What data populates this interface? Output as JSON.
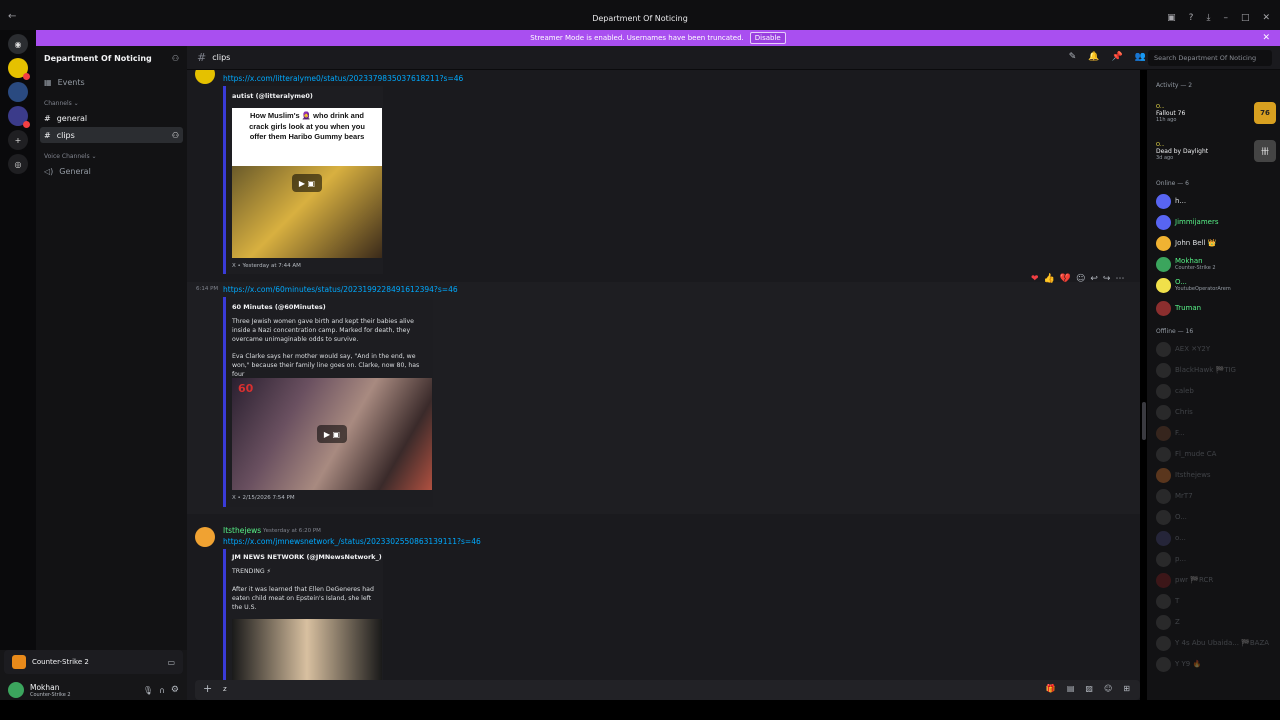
{
  "window": {
    "title": "Department Of Noticing"
  },
  "banner": {
    "text": "Streamer Mode is enabled. Usernames have been truncated.",
    "button": "Disable"
  },
  "guild": {
    "name": "Department Of Noticing"
  },
  "sidebar": {
    "events": "Events",
    "channels_category": "Channels",
    "channels": [
      {
        "name": "general"
      },
      {
        "name": "clips"
      }
    ],
    "voice_category": "Voice Channels",
    "voice_channels": [
      {
        "name": "General"
      }
    ]
  },
  "activity_card": {
    "title": "Counter-Strike 2"
  },
  "user": {
    "name": "Mokhan",
    "status": "Counter-Strike 2"
  },
  "header": {
    "channel": "clips",
    "search_placeholder": "Search Department Of Noticing"
  },
  "messages": [
    {
      "link": "https://x.com/litteralyme0/status/2023379835037618211?s=46",
      "embed_author": "autist (@litteralyme0)",
      "image_caption": "How Muslim's 🧕 who drink and crack girls look at you when you offer them Haribo Gummy bears",
      "footer": "X • Yesterday at 7:44 AM"
    },
    {
      "time": "6:14 PM",
      "link": "https://x.com/60minutes/status/2023199228491612394?s=46",
      "embed_author": "60 Minutes (@60Minutes)",
      "desc1": "Three Jewish women gave birth and kept their babies alive inside a Nazi concentration camp. Marked for death, they overcame unimaginable odds to survive.",
      "desc2": "Eva Clarke says her mother would say, \"And in the end, we won,\" because their family line goes on. Clarke, now 80, has four",
      "footer": "X • 2/15/2026 7:54 PM"
    },
    {
      "username": "Itsthejews",
      "time": "Yesterday at 6:20 PM",
      "link": "https://x.com/jmnewsnetwork_/status/2023302550863139111?s=46",
      "embed_author": "JM NEWS NETWORK (@JMNewsNetwork_)",
      "trending": "TRENDING ⚡",
      "desc": "After it was learned that Ellen DeGeneres had eaten child meat on Epstein's Island, she left the U.S."
    }
  ],
  "composer": {
    "value": "z"
  },
  "members": {
    "activity_head": "Activity — 2",
    "activities": [
      {
        "user": "O...",
        "game": "Fallout 76",
        "time": "11h ago"
      },
      {
        "user": "O...",
        "game": "Dead by Daylight",
        "time": "3d ago"
      }
    ],
    "online_head": "Online — 6",
    "online": [
      {
        "name": "h...",
        "sub": "",
        "color": "#5865f2",
        "name_color": "#dbdee1"
      },
      {
        "name": "Jimmijamers",
        "sub": "",
        "color": "#5865f2",
        "name_color": "#57f287"
      },
      {
        "name": "John Bell 👑",
        "sub": "",
        "color": "#f0b232",
        "name_color": "#dbdee1"
      },
      {
        "name": "Mokhan",
        "sub": "Counter-Strike 2",
        "color": "#3ba55d",
        "name_color": "#57f287"
      },
      {
        "name": "O...",
        "sub": "YoutubeOperatorArem",
        "color": "#f0e04a",
        "name_color": "#57f287"
      },
      {
        "name": "Truman",
        "sub": "",
        "color": "#8b2e2e",
        "name_color": "#57f287"
      }
    ],
    "offline_head": "Offline — 16",
    "offline": [
      {
        "name": "AEX ✕Y2Y",
        "color": "#555"
      },
      {
        "name": "BlackHawk 🏁TIG",
        "color": "#555"
      },
      {
        "name": "caleb",
        "color": "#555"
      },
      {
        "name": "Chris",
        "color": "#555"
      },
      {
        "name": "F...",
        "color": "#7a4a30"
      },
      {
        "name": "Fl_mude CA",
        "color": "#555"
      },
      {
        "name": "Itsthejews",
        "color": "#e07a30"
      },
      {
        "name": "MrT7",
        "color": "#555"
      },
      {
        "name": "O...",
        "color": "#555"
      },
      {
        "name": "o...",
        "color": "#4a4a80"
      },
      {
        "name": "p...",
        "color": "#555"
      },
      {
        "name": "pwr 🏁RCR",
        "color": "#8a2020"
      },
      {
        "name": "T",
        "color": "#555"
      },
      {
        "name": "Z",
        "color": "#555"
      },
      {
        "name": "Y 4s Abu Ubaida... 🏁BAZA",
        "color": "#555"
      },
      {
        "name": "Y Y9 🔥",
        "color": "#555"
      }
    ]
  }
}
